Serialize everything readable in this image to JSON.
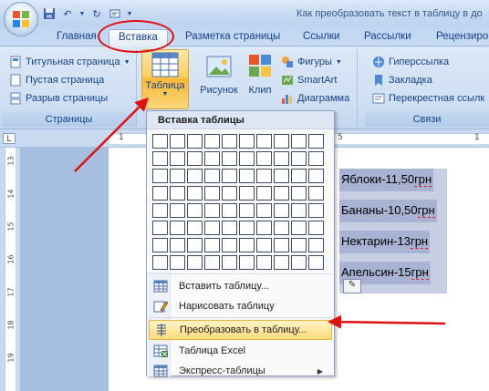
{
  "window": {
    "title": "Как преобразовать текст в таблицу в до",
    "quick_access": [
      "save-icon",
      "undo-icon",
      "redo-icon",
      "customize-icon"
    ]
  },
  "tabs": [
    {
      "label": "Главная",
      "active": false
    },
    {
      "label": "Вставка",
      "active": true
    },
    {
      "label": "Разметка страницы",
      "active": false
    },
    {
      "label": "Ссылки",
      "active": false
    },
    {
      "label": "Рассылки",
      "active": false
    },
    {
      "label": "Рецензиро",
      "active": false
    }
  ],
  "ribbon": {
    "pages_group": {
      "label": "Страницы",
      "items": [
        "Титульная страница",
        "Пустая страница",
        "Разрыв страницы"
      ]
    },
    "table_button": {
      "label": "Таблица"
    },
    "illustrations": {
      "picture": "Рисунок",
      "clip": "Клип",
      "shapes": "Фигуры",
      "smartart": "SmartArt",
      "chart": "Диаграмма"
    },
    "links_group": {
      "label": "Связи",
      "items": [
        "Гиперссылка",
        "Закладка",
        "Перекрестная ссылк"
      ]
    }
  },
  "ruler": {
    "h_numbers": [
      "1",
      "5",
      "1"
    ],
    "v_numbers": [
      "13",
      "14",
      "15",
      "16",
      "17",
      "18",
      "19"
    ]
  },
  "document": {
    "lines": [
      {
        "text": "Яблоки-11,50",
        "unit": "грн"
      },
      {
        "text": "Бананы-10,50",
        "unit": "грн"
      },
      {
        "text": "Нектарин-13",
        "unit": "грн"
      },
      {
        "text": "Апельсин-15",
        "unit": "грн"
      }
    ]
  },
  "dropdown": {
    "title": "Вставка таблицы",
    "grid": {
      "cols": 10,
      "rows": 8
    },
    "items": [
      {
        "label": "Вставить таблицу...",
        "icon": "insert-table-icon",
        "highlighted": false
      },
      {
        "label": "Нарисовать таблицу",
        "icon": "draw-table-icon",
        "highlighted": false
      },
      {
        "label": "Преобразовать в таблицу...",
        "icon": "convert-table-icon",
        "highlighted": true
      },
      {
        "label": "Таблица Excel",
        "icon": "excel-table-icon",
        "highlighted": false
      },
      {
        "label": "Экспресс-таблицы",
        "icon": "quick-tables-icon",
        "highlighted": false
      }
    ]
  },
  "colors": {
    "annotation_red": "#e01010",
    "menu_highlight": "#ffdc7a",
    "selection": "#a8b3d3"
  }
}
